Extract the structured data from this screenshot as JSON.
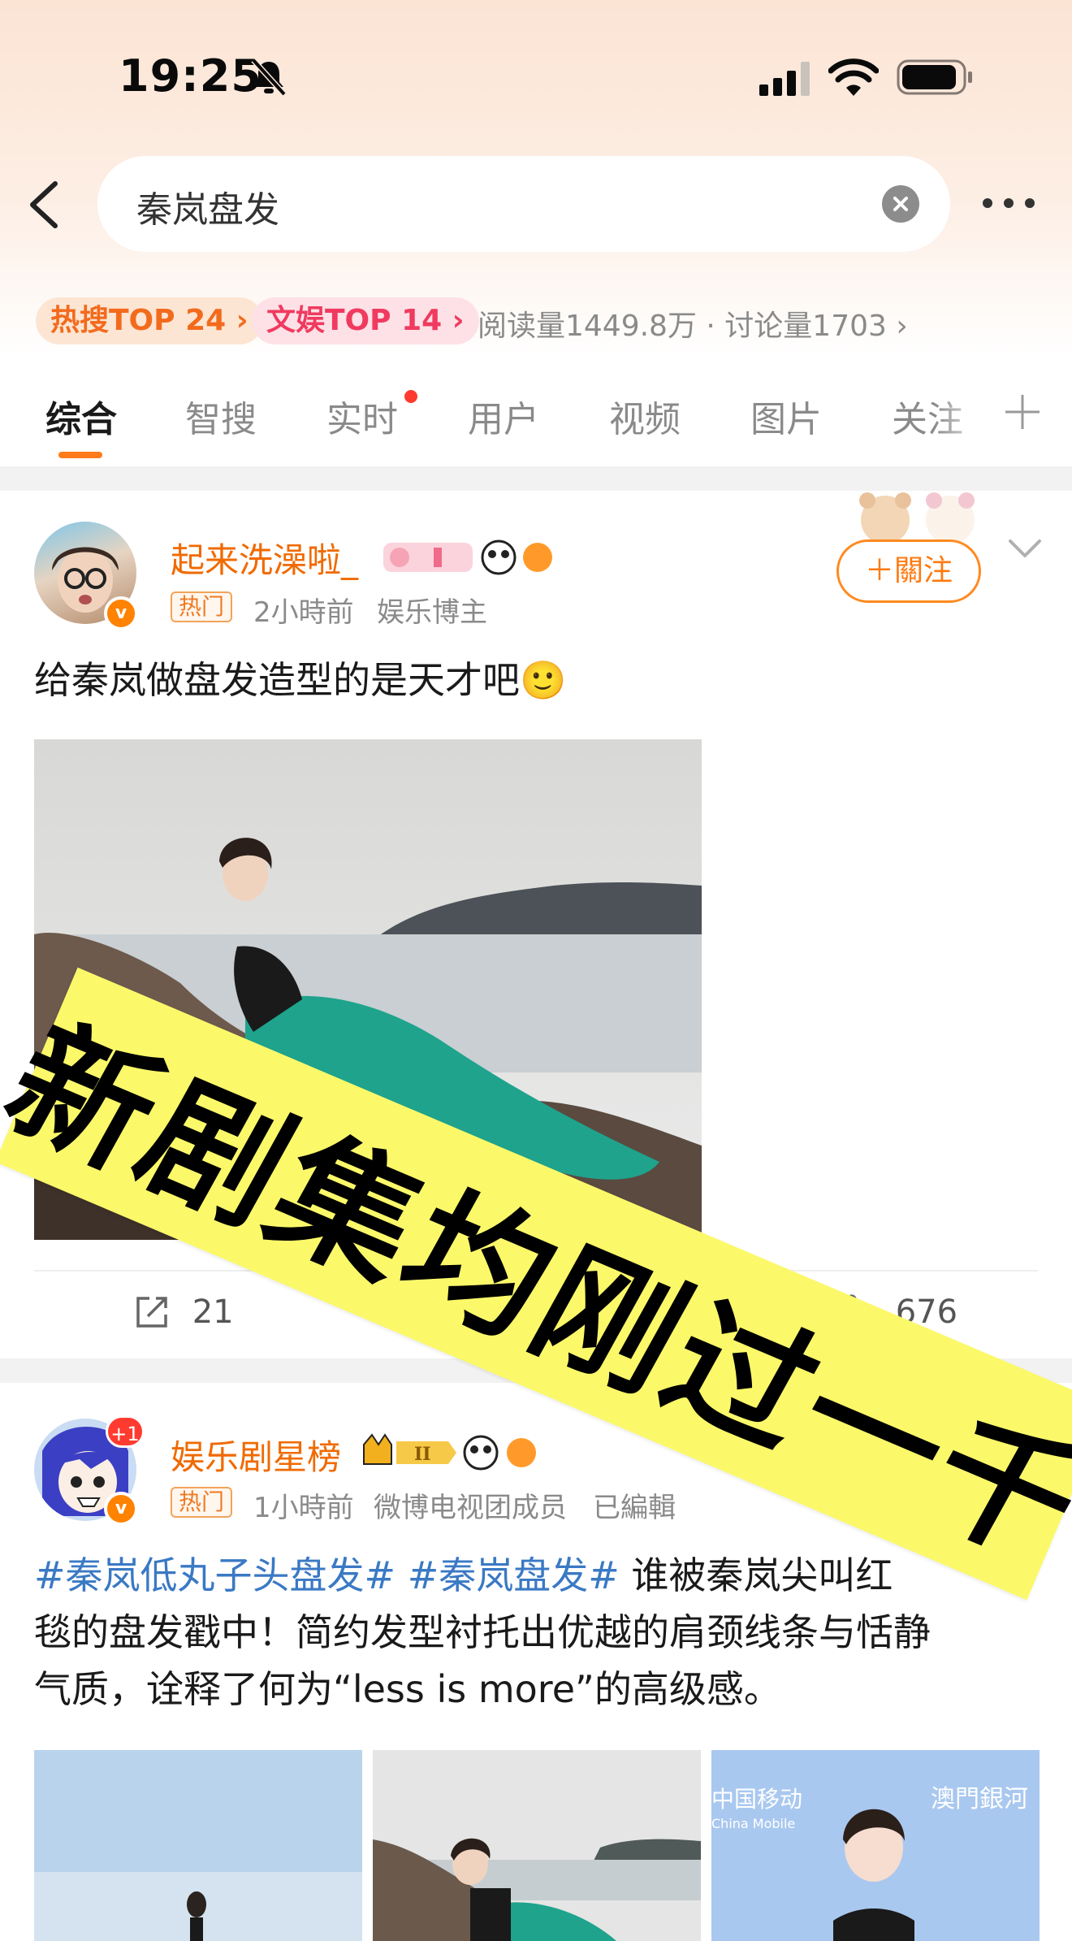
{
  "status_bar": {
    "time": "19:25"
  },
  "search": {
    "query": "秦岚盘发"
  },
  "hot_tags": {
    "hot_search": "热搜TOP 24 ›",
    "ent": "文娱TOP 14 ›",
    "stats": "阅读量1449.8万 · 讨论量1703 ›"
  },
  "tabs": [
    "综合",
    "智搜",
    "实时",
    "用户",
    "视频",
    "图片",
    "关注"
  ],
  "post1": {
    "username": "起来洗澡啦_",
    "hot_label": "热门",
    "time": "2小時前",
    "role": "娱乐博主",
    "follow": "＋關注",
    "text": "给秦岚做盘发造型的是天才吧🙂",
    "shares": "21",
    "likes": "676"
  },
  "post2": {
    "username": "娱乐剧星榜",
    "badge_plus": "+1",
    "hot_label": "热门",
    "time": "1小時前",
    "role": "微博电视团成员",
    "edited": "已編輯",
    "hashtag1": "#秦岚低丸子头盘发#",
    "hashtag2": "#秦岚盘发#",
    "text_line1": " 谁被秦岚尖叫红",
    "text_line2": "毯的盘发戳中！简约发型衬托出优越的肩颈线条与恬静",
    "text_line3": "气质，诠释了何为“less is more”的高级感。",
    "image_text": "中国移动 China Mobile · 澳門銀河"
  },
  "overlay": {
    "banner_text": "新剧集均刚过一千"
  },
  "colors": {
    "accent": "#ff8200",
    "banner": "#fbf96a",
    "hashtag": "#3a79c4"
  }
}
